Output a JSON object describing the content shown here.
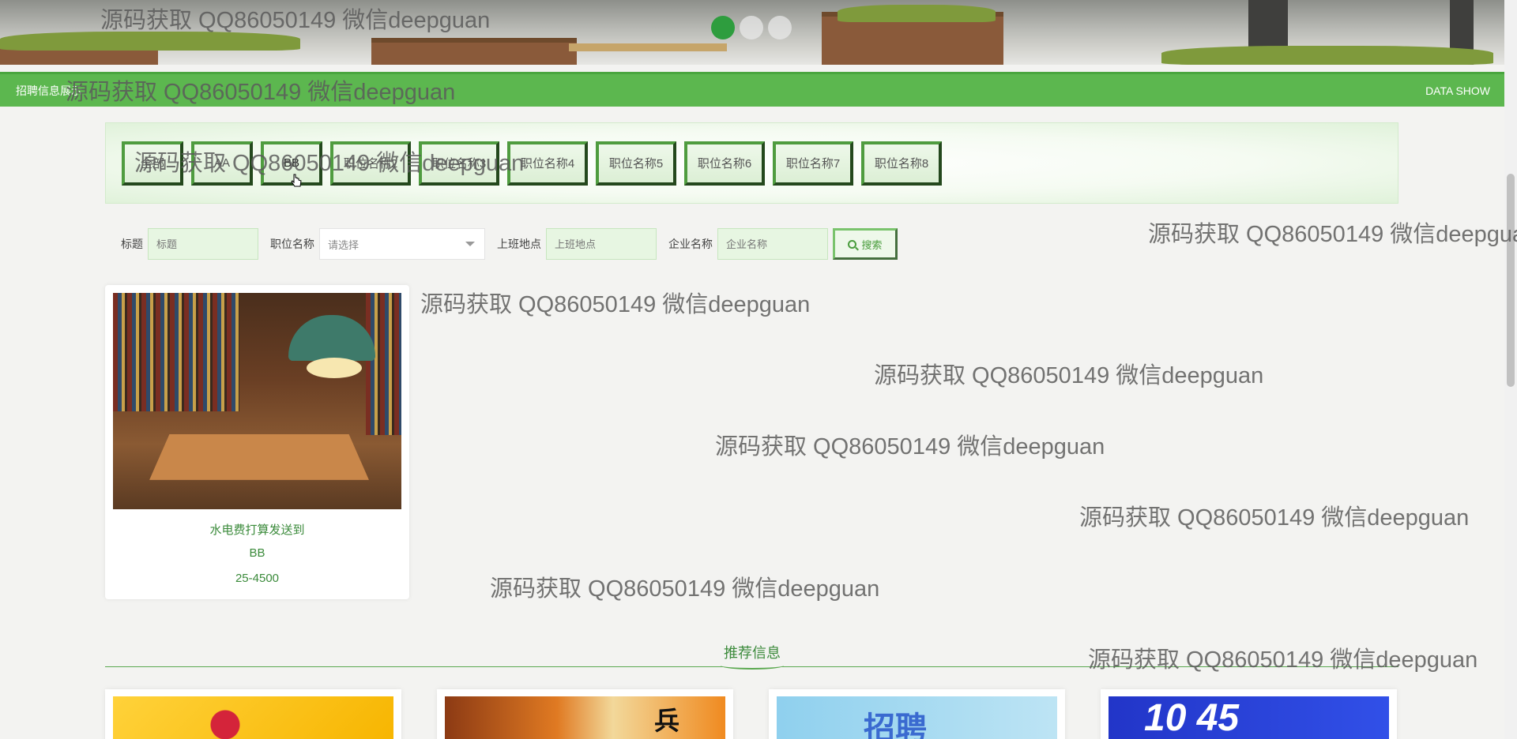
{
  "banner": {
    "active_slide": 1,
    "slide_count": 3
  },
  "navbar": {
    "left_label": "招聘信息展示",
    "right_label": "DATA SHOW"
  },
  "tabs": [
    {
      "label": "全部"
    },
    {
      "label": "AA"
    },
    {
      "label": "BB"
    },
    {
      "label": "职位名称2"
    },
    {
      "label": "职位名称3"
    },
    {
      "label": "职位名称4"
    },
    {
      "label": "职位名称5"
    },
    {
      "label": "职位名称6"
    },
    {
      "label": "职位名称7"
    },
    {
      "label": "职位名称8"
    }
  ],
  "filters": {
    "title_label": "标题",
    "title_placeholder": "标题",
    "position_label": "职位名称",
    "position_value": "请选择",
    "location_label": "上班地点",
    "location_placeholder": "上班地点",
    "company_label": "企业名称",
    "company_placeholder": "企业名称",
    "search_label": "搜索"
  },
  "listing": {
    "title": "水电费打算发送到",
    "position": "BB",
    "salary": "25-4500"
  },
  "recommend": {
    "title": "推荐信息",
    "cards": [
      {
        "text": ""
      },
      {
        "text": "兵"
      },
      {
        "text": "招聘"
      },
      {
        "text": "10 45"
      }
    ]
  },
  "watermark": "源码获取 QQ86050149 微信deepguan",
  "colors": {
    "accent": "#5cb74f",
    "accent_dark": "#3d8b3d",
    "active_dot": "#2e9d3e"
  }
}
